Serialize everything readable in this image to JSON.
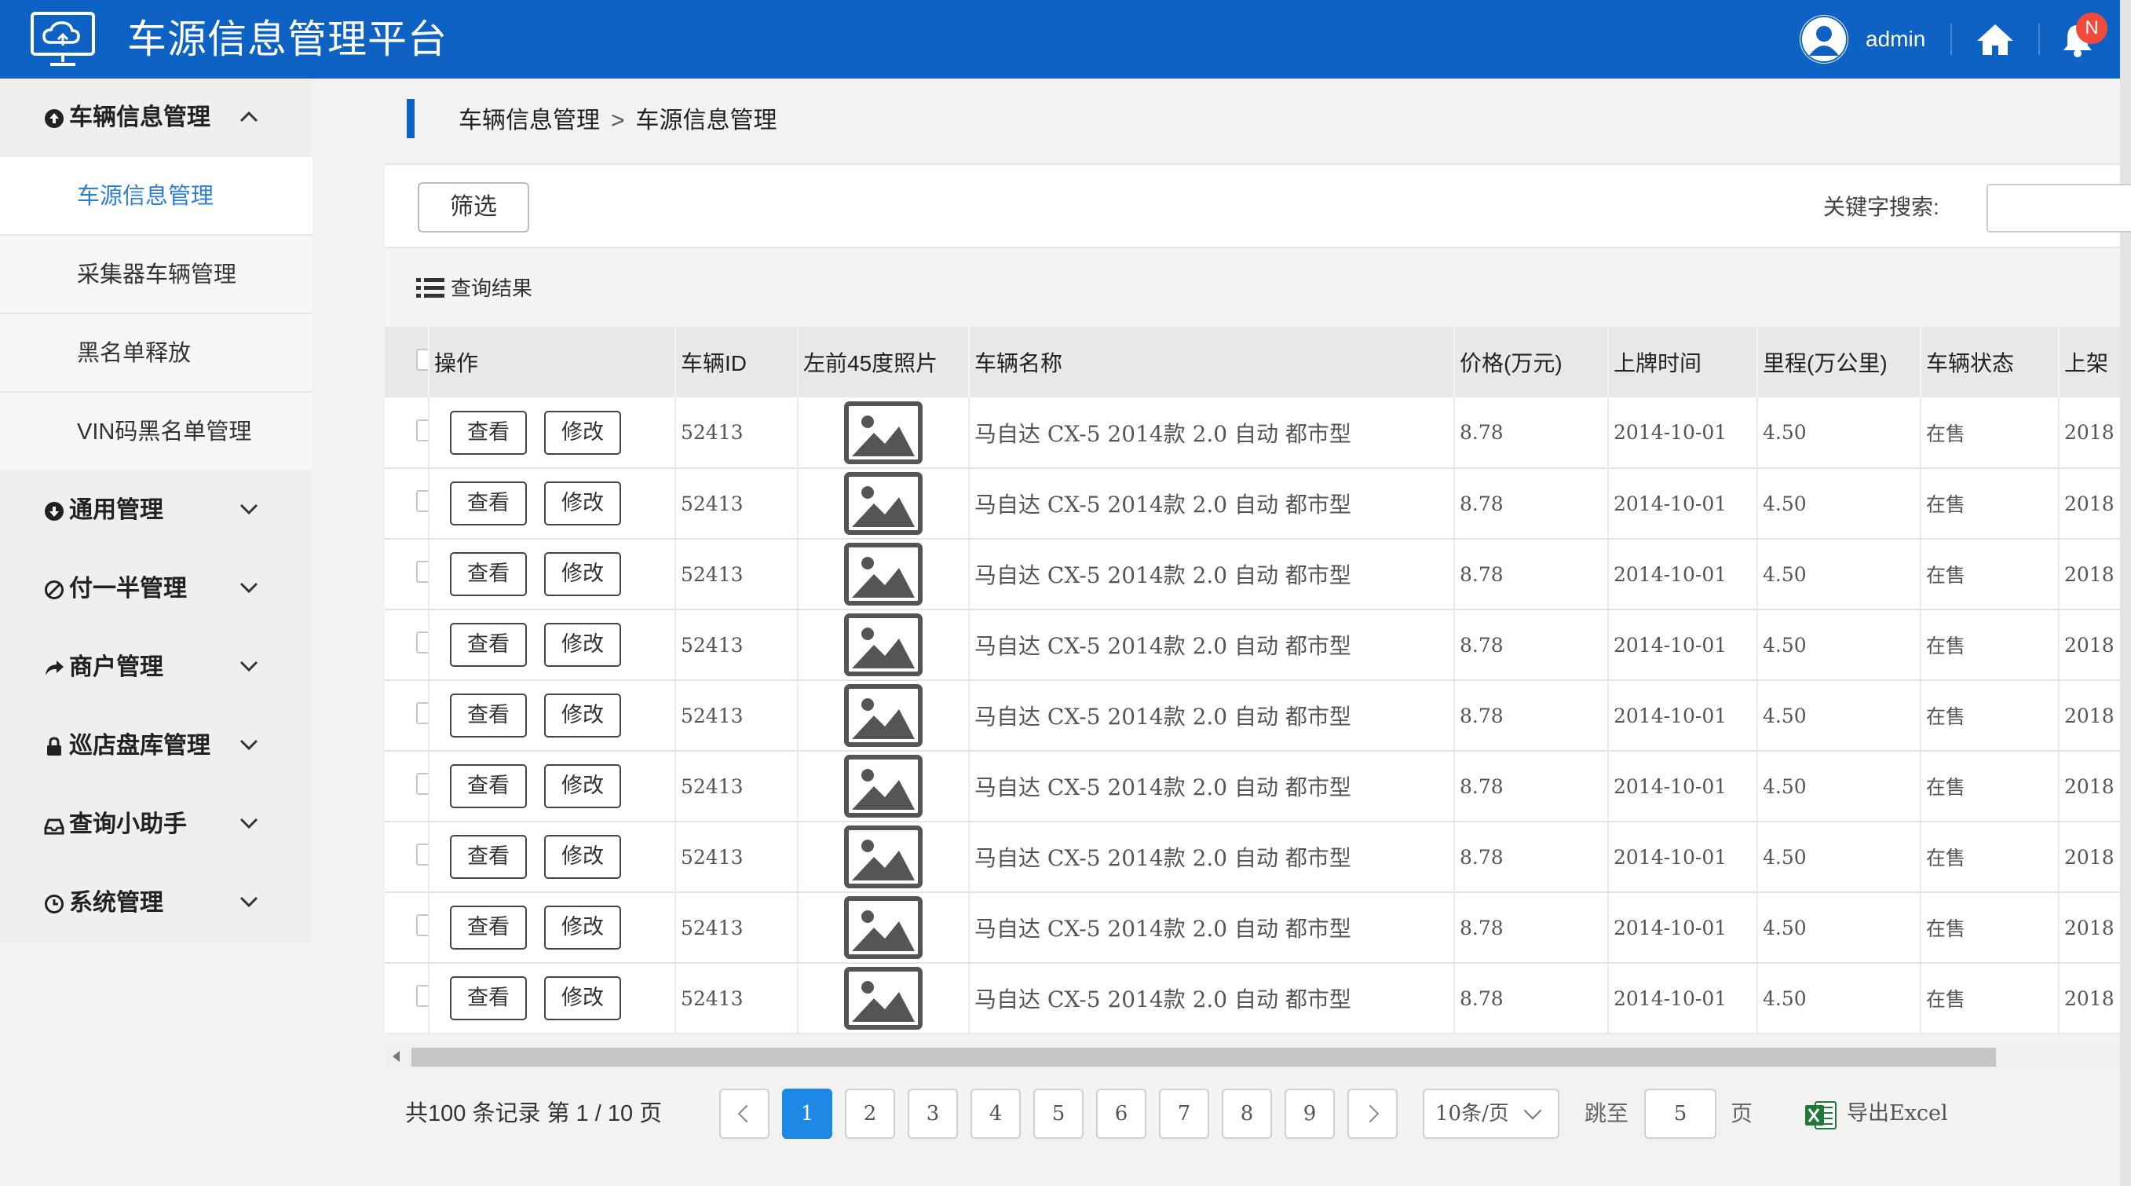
{
  "header": {
    "title": "车源信息管理平台",
    "user": "admin",
    "badge": "N"
  },
  "sidebar": {
    "groups": [
      {
        "label": "车辆信息管理",
        "icon": "circle-arrow-up-icon",
        "expanded": true,
        "items": [
          "车源信息管理",
          "采集器车辆管理",
          "黑名单释放",
          "VIN码黑名单管理"
        ]
      },
      {
        "label": "通用管理",
        "icon": "circle-arrow-down-icon"
      },
      {
        "label": "付一半管理",
        "icon": "ban-icon"
      },
      {
        "label": "商户管理",
        "icon": "share-icon"
      },
      {
        "label": "巡店盘库管理",
        "icon": "lock-icon"
      },
      {
        "label": "查询小助手",
        "icon": "inbox-icon"
      },
      {
        "label": "系统管理",
        "icon": "clock-icon"
      }
    ],
    "active_item": "车源信息管理"
  },
  "breadcrumb": {
    "parent": "车辆信息管理",
    "sep": ">",
    "current": "车源信息管理"
  },
  "filter": {
    "button": "筛选",
    "keyword_label": "关键字搜索:",
    "keyword_value": ""
  },
  "results": {
    "title": "查询结果"
  },
  "table": {
    "columns": [
      "操作",
      "车辆ID",
      "左前45度照片",
      "车辆名称",
      "价格(万元)",
      "上牌时间",
      "里程(万公里)",
      "车辆状态",
      "上架"
    ],
    "view_label": "查看",
    "edit_label": "修改",
    "rows": [
      {
        "id": "52413",
        "name": "马自达 CX-5 2014款 2.0 自动 都市型",
        "price": "8.78",
        "date": "2014-10-01",
        "mileage": "4.50",
        "status": "在售",
        "listed": "2018"
      },
      {
        "id": "52413",
        "name": "马自达 CX-5 2014款 2.0 自动 都市型",
        "price": "8.78",
        "date": "2014-10-01",
        "mileage": "4.50",
        "status": "在售",
        "listed": "2018"
      },
      {
        "id": "52413",
        "name": "马自达 CX-5 2014款 2.0 自动 都市型",
        "price": "8.78",
        "date": "2014-10-01",
        "mileage": "4.50",
        "status": "在售",
        "listed": "2018"
      },
      {
        "id": "52413",
        "name": "马自达 CX-5 2014款 2.0 自动 都市型",
        "price": "8.78",
        "date": "2014-10-01",
        "mileage": "4.50",
        "status": "在售",
        "listed": "2018"
      },
      {
        "id": "52413",
        "name": "马自达 CX-5 2014款 2.0 自动 都市型",
        "price": "8.78",
        "date": "2014-10-01",
        "mileage": "4.50",
        "status": "在售",
        "listed": "2018"
      },
      {
        "id": "52413",
        "name": "马自达 CX-5 2014款 2.0 自动 都市型",
        "price": "8.78",
        "date": "2014-10-01",
        "mileage": "4.50",
        "status": "在售",
        "listed": "2018"
      },
      {
        "id": "52413",
        "name": "马自达 CX-5 2014款 2.0 自动 都市型",
        "price": "8.78",
        "date": "2014-10-01",
        "mileage": "4.50",
        "status": "在售",
        "listed": "2018"
      },
      {
        "id": "52413",
        "name": "马自达 CX-5 2014款 2.0 自动 都市型",
        "price": "8.78",
        "date": "2014-10-01",
        "mileage": "4.50",
        "status": "在售",
        "listed": "2018"
      },
      {
        "id": "52413",
        "name": "马自达 CX-5 2014款 2.0 自动 都市型",
        "price": "8.78",
        "date": "2014-10-01",
        "mileage": "4.50",
        "status": "在售",
        "listed": "2018"
      }
    ]
  },
  "pagination": {
    "summary": "共100 条记录 第 1 / 10 页",
    "pages": [
      "1",
      "2",
      "3",
      "4",
      "5",
      "6",
      "7",
      "8",
      "9"
    ],
    "current": "1",
    "page_size": "10条/页",
    "jump_label": "跳至",
    "jump_value": "5",
    "page_unit": "页",
    "export_label": "导出Excel"
  },
  "colors": {
    "brand": "#0d62c4",
    "active_page": "#1e88e5",
    "active_menu_text": "#2b7fd8",
    "badge": "#f04a3a"
  }
}
